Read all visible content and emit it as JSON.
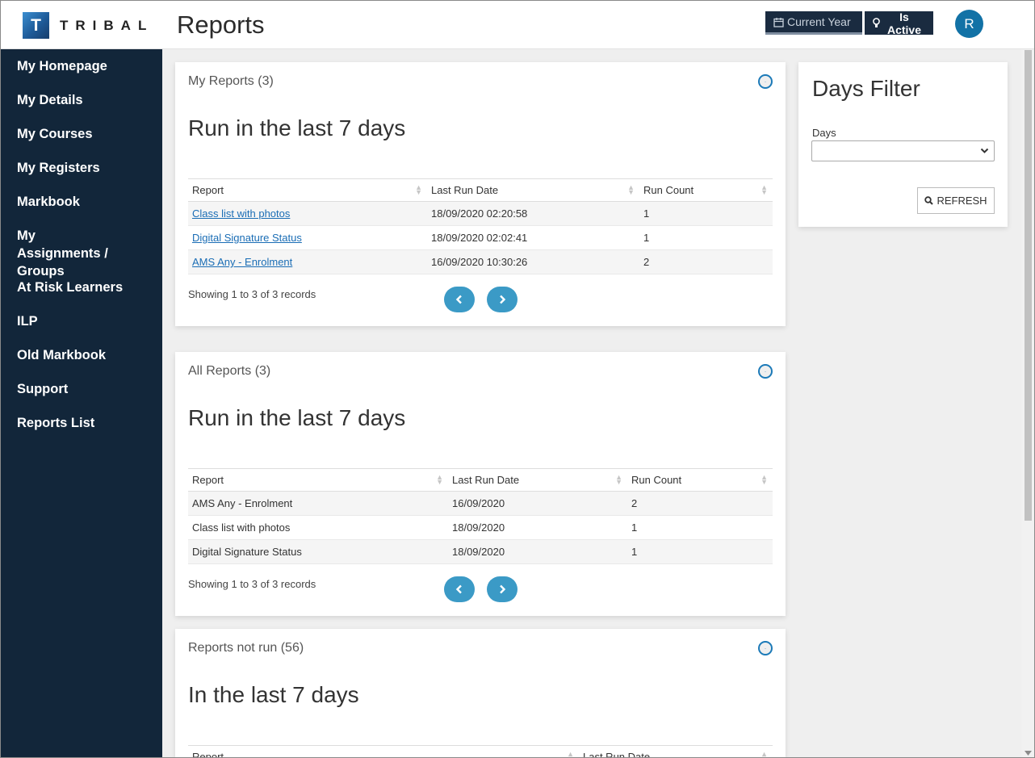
{
  "header": {
    "logo_letter": "T",
    "logo_text": "TRIBAL",
    "page_title": "Reports",
    "current_year_label": "Current Year",
    "is_active_label": "Is Active",
    "avatar_initial": "R"
  },
  "sidebar": {
    "items": [
      {
        "label": "My Homepage"
      },
      {
        "label": "My Details"
      },
      {
        "label": "My Courses"
      },
      {
        "label": "My Registers"
      },
      {
        "label": "Markbook"
      },
      {
        "label": "My Assignments / Groups"
      },
      {
        "label": "At Risk Learners"
      },
      {
        "label": "ILP"
      },
      {
        "label": "Old Markbook"
      },
      {
        "label": "Support"
      },
      {
        "label": "Reports List"
      }
    ]
  },
  "my_reports": {
    "header": "My Reports (3)",
    "title": "Run in the last 7 days",
    "columns": [
      "Report",
      "Last Run Date",
      "Run Count"
    ],
    "rows": [
      [
        "Class list with photos",
        "18/09/2020 02:20:58",
        "1"
      ],
      [
        "Digital Signature Status",
        "18/09/2020 02:02:41",
        "1"
      ],
      [
        "AMS Any - Enrolment",
        "16/09/2020 10:30:26",
        "2"
      ]
    ],
    "showing": "Showing 1 to 3 of 3 records"
  },
  "all_reports": {
    "header": "All Reports (3)",
    "title": "Run in the last 7 days",
    "columns": [
      "Report",
      "Last Run Date",
      "Run Count"
    ],
    "rows": [
      [
        "AMS Any - Enrolment",
        "16/09/2020",
        "2"
      ],
      [
        "Class list with photos",
        "18/09/2020",
        "1"
      ],
      [
        "Digital Signature Status",
        "18/09/2020",
        "1"
      ]
    ],
    "showing": "Showing 1 to 3 of 3 records"
  },
  "not_run": {
    "header": "Reports not run (56)",
    "title": "In the last 7 days",
    "columns": [
      "Report",
      "Last Run Date"
    ]
  },
  "days_filter": {
    "title": "Days Filter",
    "label": "Days",
    "selected": "",
    "refresh_label": "REFRESH"
  },
  "colors": {
    "sidebar": "#12263a",
    "accent": "#3b9ac6",
    "link": "#1a6db5",
    "header_button": "#1a2b40"
  }
}
